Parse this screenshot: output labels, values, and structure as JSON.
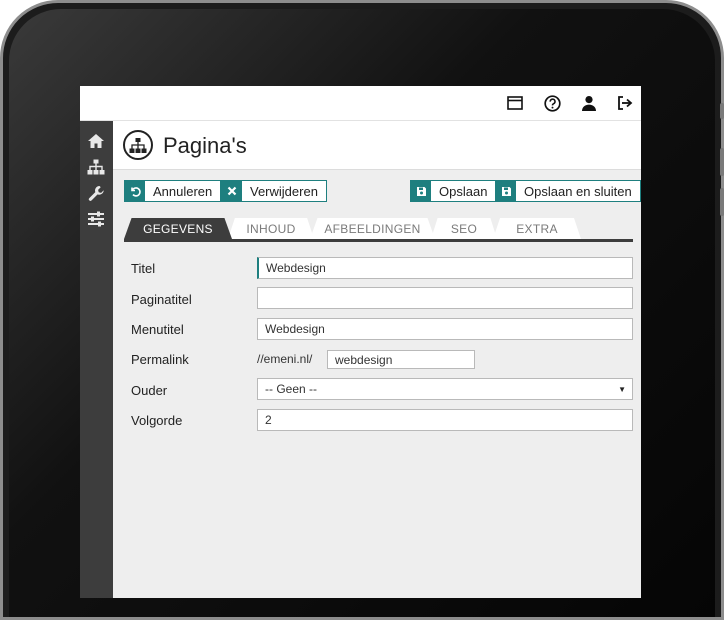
{
  "topbar": {
    "icons": [
      "window-icon",
      "help-icon",
      "user-icon",
      "logout-icon"
    ]
  },
  "rail": {
    "icons": [
      "home-icon",
      "sitemap-icon",
      "wrench-icon",
      "sliders-icon"
    ]
  },
  "header": {
    "title": "Pagina's"
  },
  "toolbar": {
    "cancel_label": "Annuleren",
    "delete_label": "Verwijderen",
    "save_label": "Opslaan",
    "save_close_label": "Opslaan en sluiten"
  },
  "tabs": [
    {
      "label": "GEGEVENS",
      "active": true
    },
    {
      "label": "INHOUD",
      "active": false
    },
    {
      "label": "AFBEELDINGEN",
      "active": false
    },
    {
      "label": "SEO",
      "active": false
    },
    {
      "label": "EXTRA",
      "active": false
    }
  ],
  "form": {
    "titel": {
      "label": "Titel",
      "value": "Webdesign"
    },
    "paginatitel": {
      "label": "Paginatitel",
      "value": ""
    },
    "menutitel": {
      "label": "Menutitel",
      "value": "Webdesign"
    },
    "permalink": {
      "label": "Permalink",
      "prefix": "//emeni.nl/",
      "value": "webdesign"
    },
    "ouder": {
      "label": "Ouder",
      "value": "-- Geen --"
    },
    "volgorde": {
      "label": "Volgorde",
      "value": "2"
    }
  },
  "colors": {
    "accent": "#1e7f7f",
    "rail": "#3d3d3d",
    "background": "#eeeeee"
  }
}
